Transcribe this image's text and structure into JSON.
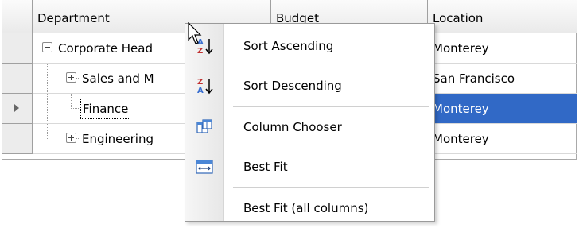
{
  "columns": [
    {
      "header": "Department"
    },
    {
      "header": "Budget"
    },
    {
      "header": "Location"
    }
  ],
  "rows": [
    {
      "department": "Corporate Head",
      "location": "Monterey",
      "expander": "collapse"
    },
    {
      "department": "Sales and M",
      "location": "San Francisco",
      "expander": "expand"
    },
    {
      "department": "Finance",
      "location": "Monterey",
      "selected": true,
      "focused": true
    },
    {
      "department": "Engineering",
      "location": "Monterey",
      "expander": "expand"
    }
  ],
  "context_menu": {
    "items": [
      {
        "label": "Sort Ascending",
        "icon": "sort-ascending-icon"
      },
      {
        "label": "Sort Descending",
        "icon": "sort-descending-icon"
      },
      {
        "label": "Column Chooser",
        "icon": "column-chooser-icon"
      },
      {
        "label": "Best Fit",
        "icon": "best-fit-icon"
      },
      {
        "label": "Best Fit (all columns)",
        "icon": ""
      }
    ]
  },
  "colors": {
    "selection": "#3169c6",
    "header_bg": "#efefef",
    "grid_border": "#a0a0a0"
  }
}
